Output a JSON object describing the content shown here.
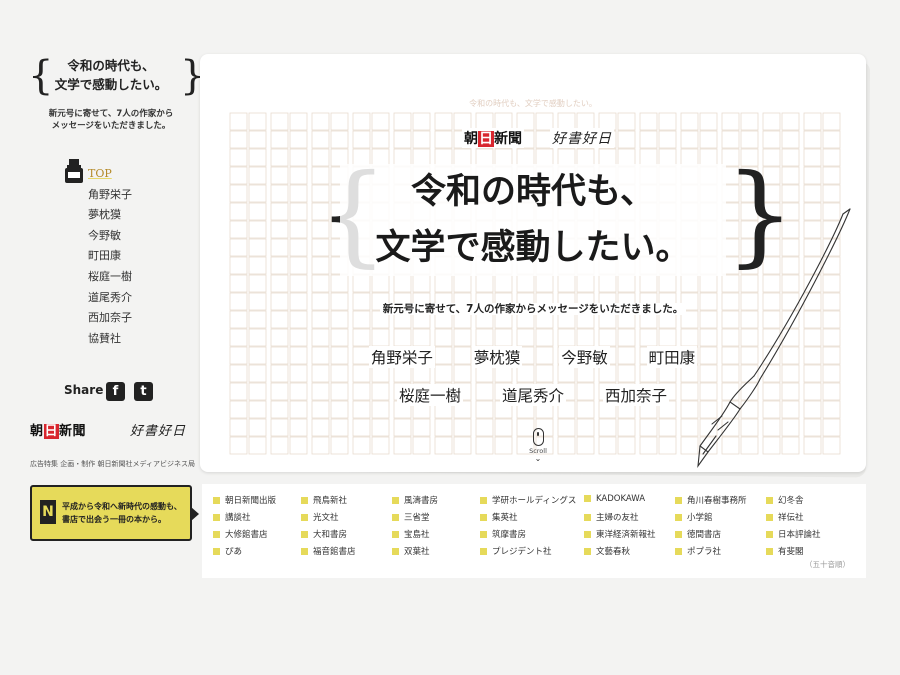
{
  "sidebar": {
    "title_line1": "令和の時代も、",
    "title_line2": "文学で感動したい。",
    "subtitle_line1": "新元号に寄せて、7人の作家から",
    "subtitle_line2": "メッセージをいただきました。",
    "nav": [
      "TOP",
      "角野栄子",
      "夢枕獏",
      "今野敏",
      "町田康",
      "桜庭一樹",
      "道尾秀介",
      "西加奈子",
      "協賛社"
    ],
    "share_label": "Share",
    "facebook_glyph": "f",
    "twitter_glyph": "t",
    "logo_asahi_1": "朝",
    "logo_asahi_2": "日",
    "logo_asahi_3": "新聞",
    "logo_kosho": "好書好日",
    "credit": "広告特集 企画・制作 朝日新聞社メディアビジネス局",
    "banner_mark": "N",
    "banner_line1": "平成から令和へ新時代の感動も、",
    "banner_line2": "書店で出会う一冊の本から。"
  },
  "main": {
    "top_caption": "令和の時代も、文学で感動したい。",
    "logo_asahi_1": "朝",
    "logo_asahi_2": "日",
    "logo_asahi_3": "新聞",
    "logo_kosho": "好書好日",
    "headline_line1": "令和の時代も、",
    "headline_line2": "文学で感動したい。",
    "lead": "新元号に寄せて、7人の作家からメッセージをいただきました。",
    "authors_row1": [
      "角野栄子",
      "夢枕獏",
      "今野敏",
      "町田康"
    ],
    "authors_row2": [
      "桜庭一樹",
      "道尾秀介",
      "西加奈子"
    ],
    "scroll_label": "Scroll"
  },
  "publishers": {
    "columns": [
      [
        "朝日新聞出版",
        "講談社",
        "大修館書店",
        "ぴあ"
      ],
      [
        "飛鳥新社",
        "光文社",
        "大和書房",
        "福音館書店"
      ],
      [
        "風濤書房",
        "三省堂",
        "宝島社",
        "双葉社"
      ],
      [
        "学研ホールディングス",
        "集英社",
        "筑摩書房",
        "プレジデント社"
      ],
      [
        "KADOKAWA",
        "主婦の友社",
        "東洋経済新報社",
        "文藝春秋"
      ],
      [
        "角川春樹事務所",
        "小学館",
        "徳間書店",
        "ポプラ社"
      ],
      [
        "幻冬舎",
        "祥伝社",
        "日本評論社",
        "有斐閣"
      ]
    ],
    "note": "（五十音順）"
  },
  "colors": {
    "accent_yellow": "#e6da5a",
    "asahi_red": "#d8262e",
    "text": "#222222",
    "grid_line": "#e8dcd0"
  }
}
